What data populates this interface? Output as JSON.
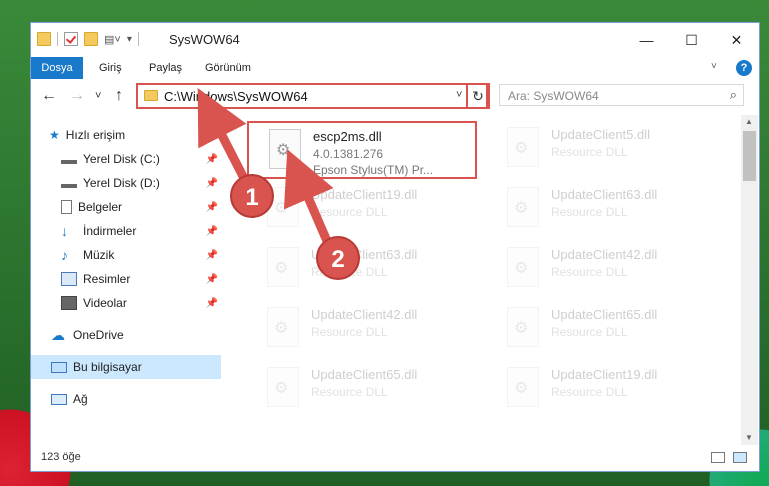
{
  "window": {
    "title": "SysWOW64",
    "controls": {
      "minimize": "—",
      "maximize": "☐",
      "close": "✕"
    }
  },
  "ribbon": {
    "tabs": [
      "Dosya",
      "Giriş",
      "Paylaş",
      "Görünüm"
    ],
    "help": "?"
  },
  "navigation": {
    "back": "←",
    "forward": "→",
    "recent": "˅",
    "up": "↑",
    "address": "C:\\Windows\\SysWOW64",
    "address_dropdown": "˅",
    "refresh": "↻",
    "search_placeholder": "Ara: SysWOW64"
  },
  "sidebar": {
    "quick_access": "Hızlı erişim",
    "items": [
      {
        "label": "Yerel Disk (C:)",
        "icon": "drive-icon",
        "pinned": true
      },
      {
        "label": "Yerel Disk (D:)",
        "icon": "drive-icon",
        "pinned": true
      },
      {
        "label": "Belgeler",
        "icon": "documents-icon",
        "pinned": true
      },
      {
        "label": "İndirmeler",
        "icon": "downloads-icon",
        "pinned": true
      },
      {
        "label": "Müzik",
        "icon": "music-icon",
        "pinned": true
      },
      {
        "label": "Resimler",
        "icon": "pictures-icon",
        "pinned": true
      },
      {
        "label": "Videolar",
        "icon": "videos-icon",
        "pinned": true
      }
    ],
    "onedrive": "OneDrive",
    "this_pc": "Bu bilgisayar",
    "network": "Ağ"
  },
  "files": [
    {
      "name": "escp2ms.dll",
      "sub1": "4.0.1381.276",
      "sub2": "Epson Stylus(TM) Pr...",
      "highlight": true
    },
    {
      "name": "UpdateClient5.dll",
      "sub1": "Resource DLL",
      "sub2": ""
    },
    {
      "name": "UpdateClient19.dll",
      "sub1": "Resource DLL",
      "sub2": ""
    },
    {
      "name": "UpdateClient63.dll",
      "sub1": "Resource DLL",
      "sub2": ""
    },
    {
      "name": "UpdateClient63.dll",
      "sub1": "Resource DLL",
      "sub2": ""
    },
    {
      "name": "UpdateClient42.dll",
      "sub1": "Resource DLL",
      "sub2": ""
    },
    {
      "name": "UpdateClient42.dll",
      "sub1": "Resource DLL",
      "sub2": ""
    },
    {
      "name": "UpdateClient65.dll",
      "sub1": "Resource DLL",
      "sub2": ""
    },
    {
      "name": "UpdateClient65.dll",
      "sub1": "Resource DLL",
      "sub2": ""
    },
    {
      "name": "UpdateClient19.dll",
      "sub1": "Resource DLL",
      "sub2": ""
    }
  ],
  "status": {
    "count": "123 öğe"
  },
  "annotations": {
    "step1": "1",
    "step2": "2",
    "color": "#d9534f"
  }
}
